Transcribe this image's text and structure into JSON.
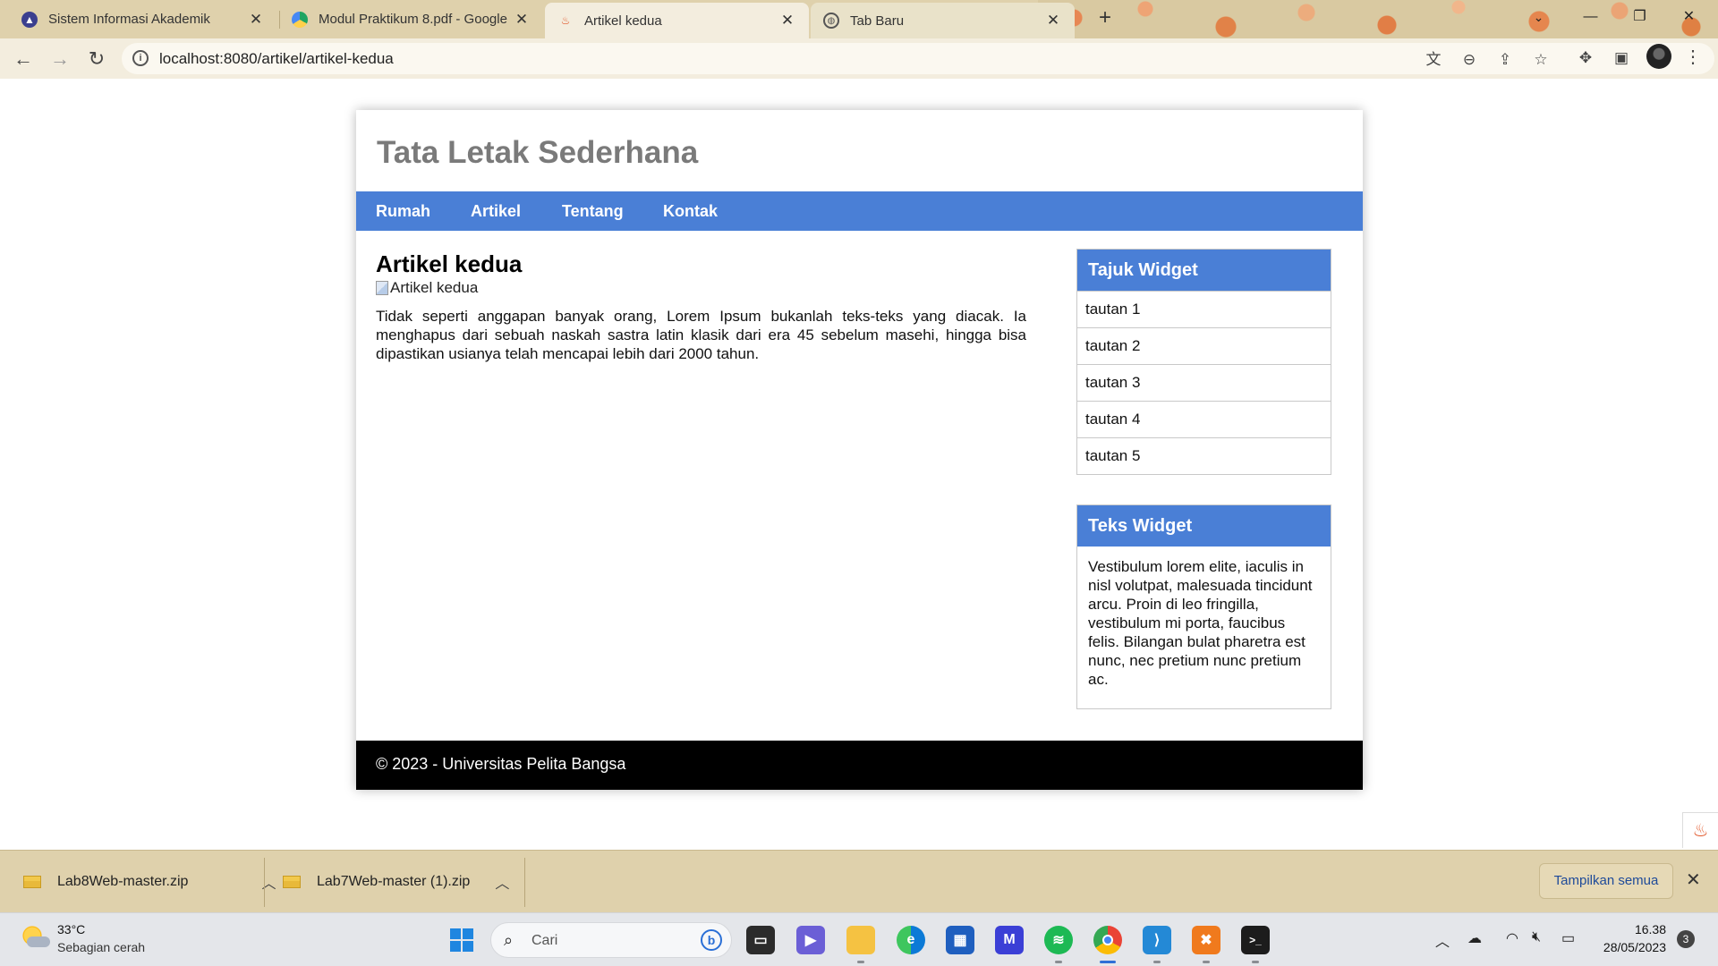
{
  "browser": {
    "tabs": [
      {
        "label": "Sistem Informasi Akademik"
      },
      {
        "label": "Modul Praktikum 8.pdf - Google"
      },
      {
        "label": "Artikel kedua"
      },
      {
        "label": "Tab Baru"
      }
    ],
    "new_tab": "+",
    "close_glyph": "✕",
    "url": "localhost:8080/artikel/artikel-kedua"
  },
  "page": {
    "site_title": "Tata Letak Sederhana",
    "nav": [
      "Rumah",
      "Artikel",
      "Tentang",
      "Kontak"
    ],
    "article": {
      "title": "Artikel kedua",
      "image_alt": "Artikel kedua",
      "body": "Tidak seperti anggapan banyak orang, Lorem Ipsum bukanlah teks-teks yang diacak. Ia menghapus dari sebuah naskah sastra latin klasik dari era 45 sebelum masehi, hingga bisa dipastikan usianya telah mencapai lebih dari 2000 tahun."
    },
    "widget_links": {
      "title": "Tajuk Widget",
      "links": [
        "tautan 1",
        "tautan 2",
        "tautan 3",
        "tautan 4",
        "tautan 5"
      ]
    },
    "widget_text": {
      "title": "Teks Widget",
      "text": "Vestibulum lorem elite, iaculis in nisl volutpat, malesuada tincidunt arcu. Proin di leo fringilla, vestibulum mi porta, faucibus felis. Bilangan bulat pharetra est nunc, nec pretium nunc pretium ac."
    },
    "footer": "© 2023 - Universitas Pelita Bangsa"
  },
  "downloads": {
    "items": [
      "Lab8Web-master.zip",
      "Lab7Web-master (1).zip"
    ],
    "show_all": "Tampilkan semua"
  },
  "taskbar": {
    "weather_temp": "33°C",
    "weather_desc": "Sebagian cerah",
    "search_placeholder": "Cari",
    "time": "16.38",
    "date": "28/05/2023",
    "notification_count": "3"
  },
  "colors": {
    "accent_blue": "#4a7fd6",
    "footer_bg": "#000000",
    "browser_frame": "#dfd1ac"
  }
}
